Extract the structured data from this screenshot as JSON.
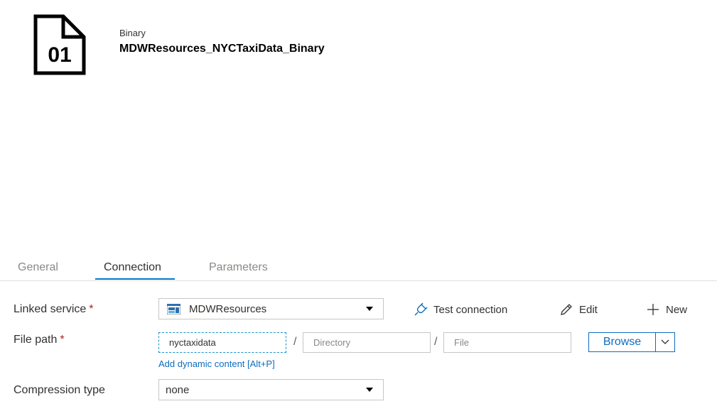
{
  "header": {
    "icon_text": "01",
    "dataset_type": "Binary",
    "dataset_name": "MDWResources_NYCTaxiData_Binary"
  },
  "tabs": [
    {
      "label": "General",
      "active": false
    },
    {
      "label": "Connection",
      "active": true
    },
    {
      "label": "Parameters",
      "active": false
    }
  ],
  "form": {
    "linked_service": {
      "label": "Linked service",
      "required_mark": "*",
      "value": "MDWResources"
    },
    "actions": {
      "test_connection": "Test connection",
      "edit": "Edit",
      "new": "New"
    },
    "file_path": {
      "label": "File path",
      "required_mark": "*",
      "container_value": "nyctaxidata",
      "directory_placeholder": "Directory",
      "file_placeholder": "File",
      "separator": "/",
      "browse_label": "Browse",
      "dynamic_link": "Add dynamic content [Alt+P]"
    },
    "compression": {
      "label": "Compression type",
      "value": "none"
    }
  },
  "colors": {
    "accent": "#0078d4",
    "link": "#0f6cbd",
    "required": "#a4262c"
  }
}
